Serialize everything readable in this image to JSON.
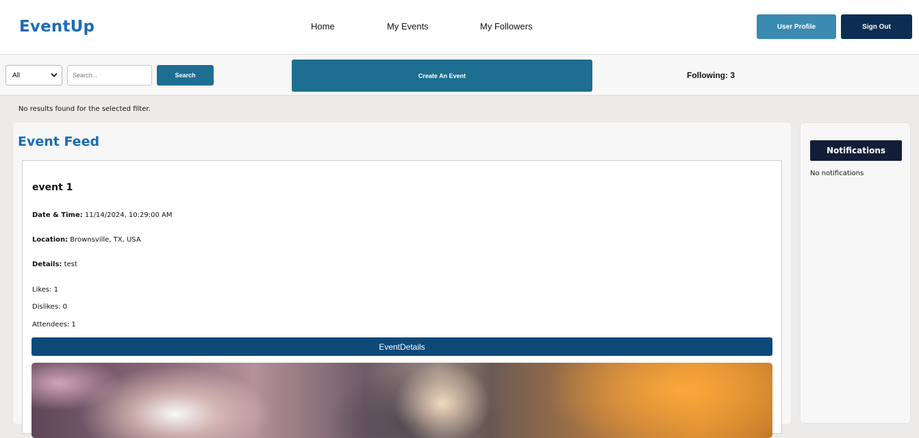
{
  "header": {
    "brand": "EventUp",
    "nav": [
      "Home",
      "My Events",
      "My Followers"
    ],
    "profile_label": "User Profile",
    "signout_label": "Sign Out"
  },
  "toolbar": {
    "filter_value": "All",
    "search_placeholder": "Search...",
    "search_label": "Search",
    "create_label": "Create An Event",
    "following_label": "Following: 3"
  },
  "filter_message": "No results found for the selected filter.",
  "feed": {
    "title": "Event Feed",
    "events": [
      {
        "title": "event 1",
        "datetime_label": "Date & Time:",
        "datetime": " 11/14/2024, 10:29:00 AM",
        "location_label": "Location:",
        "location": " Brownsville, TX, USA",
        "details_label": "Details:",
        "details": " test",
        "likes": "Likes: 1",
        "dislikes": "Dislikes: 0",
        "attendees": "Attendees: 1",
        "details_button": "EventDetails"
      }
    ]
  },
  "notifications": {
    "title": "Notifications",
    "empty": "No notifications"
  },
  "colors": {
    "brand": "#1a6bb8",
    "primary_button": "#1e6e91",
    "dark_button": "#0b2e52",
    "details_button": "#0d4a7a"
  }
}
